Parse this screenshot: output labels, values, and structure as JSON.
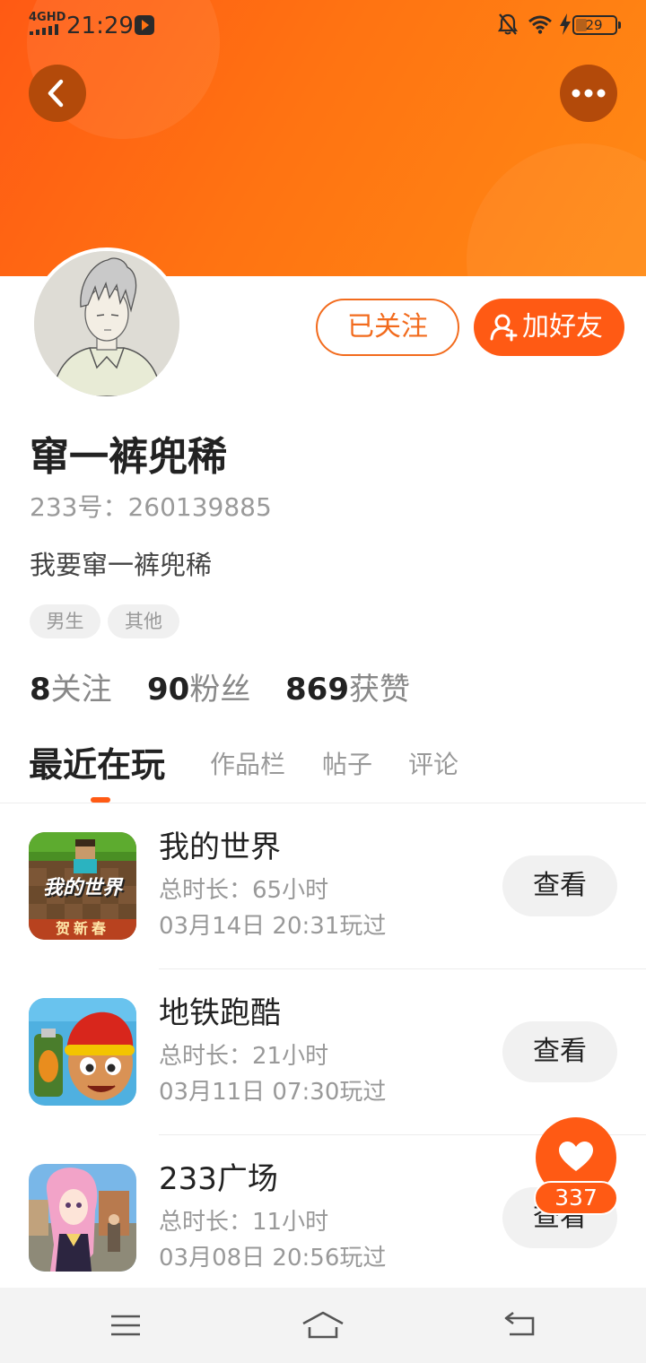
{
  "status_bar": {
    "network": "4GHD",
    "time": "21:29",
    "battery": "29",
    "battery_level": 0.29
  },
  "header": {
    "back_icon": "chevron-left-icon",
    "more_icon": "more-dots-icon"
  },
  "profile": {
    "followed_label": "已关注",
    "add_friend_label": "加好友",
    "name": "窜一裤兜稀",
    "uid": "233号：260139885",
    "bio": "我要窜一裤兜稀",
    "tags": [
      "男生",
      "其他"
    ],
    "stats": [
      {
        "value": "8",
        "label": "关注"
      },
      {
        "value": "90",
        "label": "粉丝"
      },
      {
        "value": "869",
        "label": "获赞"
      }
    ]
  },
  "tabs": [
    "最近在玩",
    "作品栏",
    "帖子",
    "评论"
  ],
  "games": [
    {
      "title": "我的世界",
      "duration": "总时长：65小时",
      "last_played": "03月14日 20:31玩过",
      "view_label": "查看",
      "icon_text": "我的世界",
      "icon_sub": "贺新春"
    },
    {
      "title": "地铁跑酷",
      "duration": "总时长：21小时",
      "last_played": "03月11日 07:30玩过",
      "view_label": "查看"
    },
    {
      "title": "233广场",
      "duration": "总时长：11小时",
      "last_played": "03月08日 20:56玩过",
      "view_label": "查看"
    }
  ],
  "like": {
    "count": "337"
  },
  "colors": {
    "accent": "#ff5a14",
    "banner": "#ff7312"
  }
}
